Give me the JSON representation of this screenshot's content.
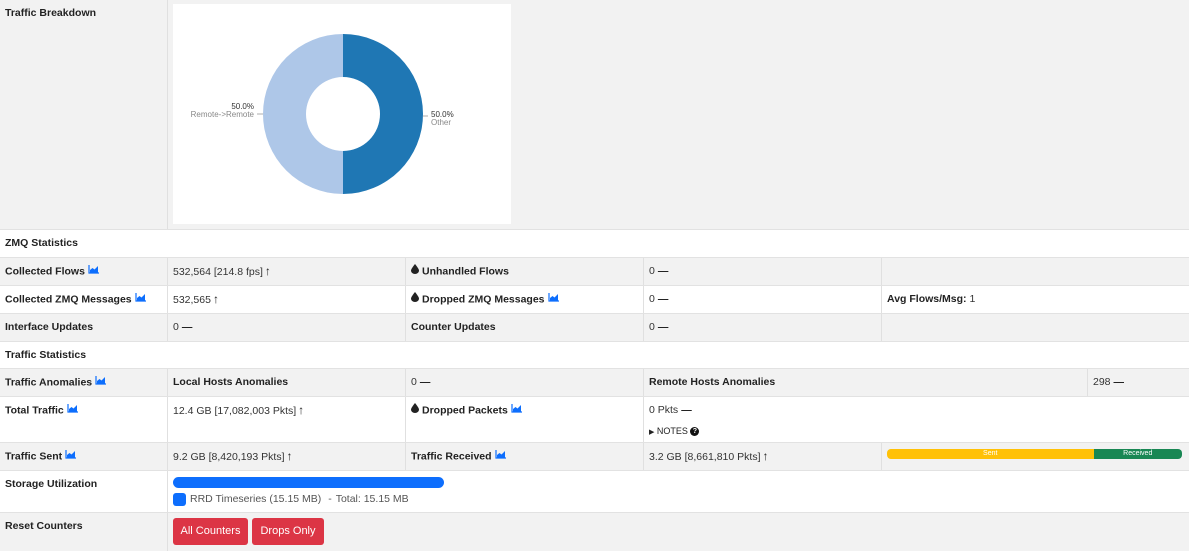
{
  "breakdown": {
    "label": "Traffic Breakdown",
    "chart_data": {
      "type": "pie",
      "title": "",
      "slices": [
        {
          "name": "Other",
          "percent": 50.0,
          "label": "50.0%",
          "color": "#1f77b4"
        },
        {
          "name": "Remote->Remote",
          "percent": 50.0,
          "label": "50.0%",
          "color": "#aec7e8"
        }
      ]
    }
  },
  "zmq": {
    "title": "ZMQ Statistics",
    "collected_flows": {
      "label": "Collected Flows",
      "value": "532,564 [214.8 fps]"
    },
    "unhandled_flows": {
      "label": "Unhandled Flows",
      "value": "0"
    },
    "collected_msgs": {
      "label": "Collected ZMQ Messages",
      "value": "532,565"
    },
    "dropped_msgs": {
      "label": "Dropped ZMQ Messages",
      "value": "0"
    },
    "avg_flows": {
      "label": "Avg Flows/Msg:",
      "value": "1"
    },
    "interface_updates": {
      "label": "Interface Updates",
      "value": "0"
    },
    "counter_updates": {
      "label": "Counter Updates",
      "value": "0"
    }
  },
  "traffic": {
    "title": "Traffic Statistics",
    "anomalies": {
      "label": "Traffic Anomalies"
    },
    "local_anomalies": {
      "label": "Local Hosts Anomalies",
      "value": "0"
    },
    "remote_anomalies": {
      "label": "Remote Hosts Anomalies",
      "value": "298"
    },
    "total": {
      "label": "Total Traffic",
      "value": "12.4 GB [17,082,003 Pkts]"
    },
    "dropped_packets": {
      "label": "Dropped Packets",
      "value": "0 Pkts",
      "notes": "NOTES"
    },
    "sent": {
      "label": "Traffic Sent",
      "value": "9.2 GB [8,420,193 Pkts]"
    },
    "received": {
      "label": "Traffic Received",
      "value": "3.2 GB [8,661,810 Pkts]"
    },
    "split_bar": {
      "sent_label": "Sent",
      "received_label": "Received",
      "sent_fraction": 0.7,
      "sent_color": "#ffc107",
      "received_color": "#198754"
    }
  },
  "storage": {
    "label": "Storage Utilization",
    "bar_color": "#0d6efd",
    "legend": "RRD Timeseries (15.15 MB)",
    "separator": "-",
    "total": "Total: 15.15 MB"
  },
  "reset": {
    "label": "Reset Counters",
    "all_counters": "All Counters",
    "drops_only": "Drops Only"
  }
}
